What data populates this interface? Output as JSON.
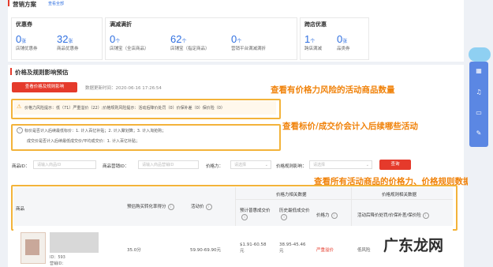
{
  "header": {
    "title": "营销方案",
    "view_all": "查看全部"
  },
  "panels": {
    "coupon": {
      "title": "优惠券",
      "stats": [
        {
          "value": "0",
          "unit": "张",
          "label": "店铺优惠券"
        },
        {
          "value": "32",
          "unit": "张",
          "label": "商品优惠券"
        }
      ]
    },
    "fullcut": {
      "title": "满减满折",
      "stats": [
        {
          "value": "0",
          "unit": "个",
          "label": "店铺宝（全店商品）"
        },
        {
          "value": "62",
          "unit": "个",
          "label": "店铺宝（指定商品）"
        },
        {
          "value": "0",
          "unit": "个",
          "label": "营销平台满减满折"
        }
      ]
    },
    "crossstore": {
      "title": "跨店优惠",
      "stats": [
        {
          "value": "1",
          "unit": "个",
          "label": "跨店满减"
        },
        {
          "value": "0",
          "unit": "张",
          "label": "品类券"
        }
      ]
    }
  },
  "price_section": {
    "title": "价格及规则影响预估",
    "view_button": "查看价格及规则影响",
    "update_time": "数据更新时间：2020-06-16 17:26:54",
    "warning": "价格力风险提示：低（71）严重溢价（22）;价格规则风险提示：活动后降价处罚（0）价保补差（0）保价险（0）",
    "info_line1": "标价是否计入后续最低标价：1. 计入百亿补贴；2. 计入聚划算；3. 计入淘抢购；",
    "info_line2": "成交价是否计入后续最低成交价/平均成交价：1. 计入百亿补贴；"
  },
  "annotations": {
    "a1": "查看有价格力风险的活动商品数量",
    "a2": "查看标价/成交价会计入后续哪些活动",
    "a3": "查看所有活动商品的价格力、价格规则数据"
  },
  "filters": {
    "product_id_label": "商品ID：",
    "product_id_placeholder": "请输入商品ID",
    "shop_product_id_label": "商品营销ID：",
    "shop_product_id_placeholder": "请输入商品营销ID",
    "price_power_label": "价格力：",
    "price_power_placeholder": "请选择",
    "rule_impact_label": "价格规则影响：",
    "rule_impact_placeholder": "请选择",
    "query_button": "查询"
  },
  "table": {
    "group_price": "价格力相关数据",
    "group_rule": "价格规则相关数据",
    "col_product": "商品",
    "col_conversion": "预估购买转化率得分",
    "col_activity_price": "活动价",
    "col_expected_price": "预计普惠成交价",
    "col_history_low": "历史最低成交价",
    "col_price_power": "价格力",
    "col_post_penalty": "活动后降价处罚/价保补差/保价险",
    "row": {
      "id_line1": "ID：593",
      "id_line2": "营销ID：",
      "conversion": "35.0分",
      "activity_price": "59.90-69.90元",
      "expected_price": "$1.91-60.58元",
      "history_low": "38.95-45.46元",
      "price_power": "严重溢价",
      "post_penalty": "低风险"
    }
  },
  "watermark": "广东龙网"
}
